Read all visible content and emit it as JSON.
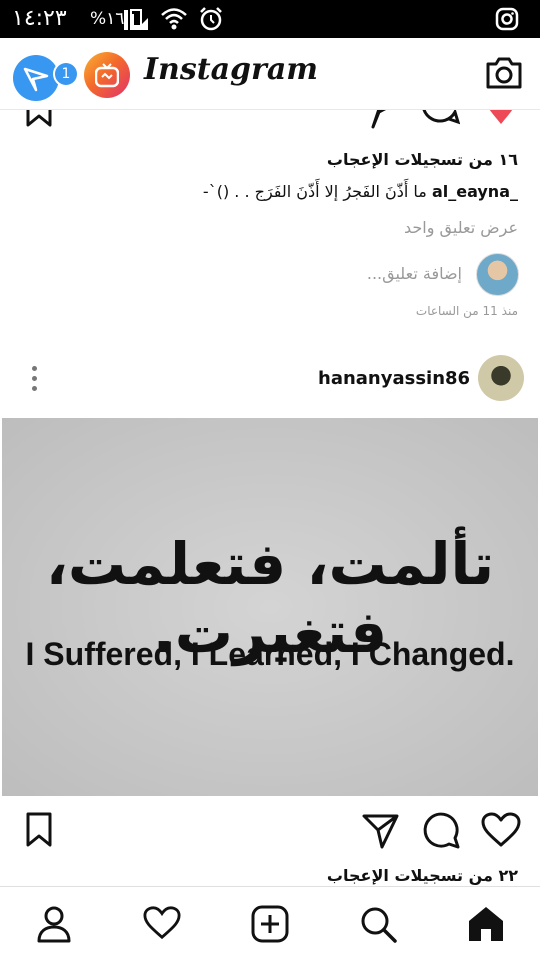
{
  "status_bar": {
    "time": "١٤:٢٣",
    "battery": "%١٦",
    "icons": [
      "signal-icon",
      "wifi-icon",
      "alarm-icon",
      "instagram-notification-icon"
    ]
  },
  "header": {
    "app_name": "Instagram",
    "dm_badge": "1",
    "icons": [
      "direct-message-icon",
      "igtv-icon",
      "camera-icon"
    ]
  },
  "post1": {
    "likes": "١٦ من تسجيلات الإعجاب",
    "caption_user": "al_eayna_",
    "caption_text": "-`() . . ما أَذّنَ الفَجرُ إلا أَذّنَ الفَرَج",
    "view_comments": "عرض تعليق واحد",
    "add_comment_placeholder": "إضافة تعليق...",
    "time": "منذ 11 من الساعات"
  },
  "post2": {
    "username": "hananyassin86",
    "image_text_arabic": "تألمت، فتعلمت، فتغيرت.",
    "image_text_english": "I Suffered, I Learned, I Changed.",
    "likes": "٢٢ من تسجيلات الإعجاب"
  },
  "bottom_nav": {
    "items": [
      "profile-icon",
      "activity-heart-icon",
      "new-post-icon",
      "search-icon",
      "home-icon"
    ]
  }
}
